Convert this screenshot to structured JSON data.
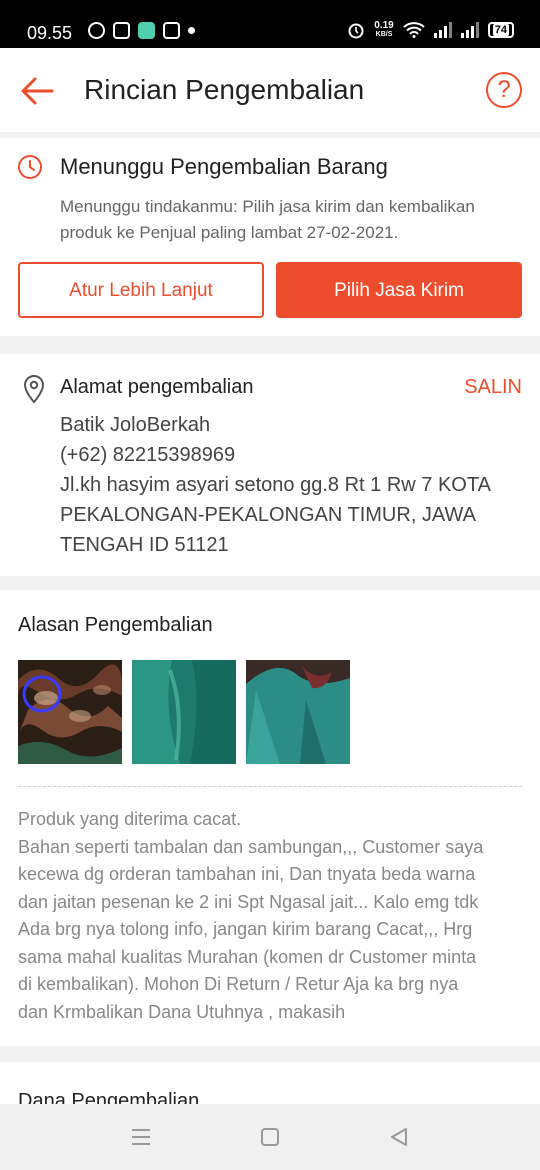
{
  "status_bar": {
    "time": "09.55",
    "speed_value": "0.19",
    "speed_unit": "KB/S",
    "battery": "74",
    "icons": [
      "plus-circle-icon",
      "notification-icon",
      "app-icon",
      "image-icon",
      "dot-icon",
      "alarm-icon",
      "wifi-icon",
      "signal-icon",
      "signal-icon",
      "battery-icon"
    ]
  },
  "header": {
    "title": "Rincian Pengembalian",
    "back_icon": "arrow-left-icon",
    "help_icon": "question-circle-icon",
    "help_symbol": "?"
  },
  "status_card": {
    "icon": "clock-icon",
    "title": "Menunggu Pengembalian Barang",
    "description": "Menunggu tindakanmu: Pilih jasa kirim dan kembalikan produk ke Penjual paling lambat 27-02-2021.",
    "secondary_button": "Atur Lebih Lanjut",
    "primary_button": "Pilih Jasa Kirim"
  },
  "address_card": {
    "icon": "location-pin-icon",
    "label": "Alamat pengembalian",
    "copy_label": "SALIN",
    "name": "Batik JoloBerkah",
    "phone": "(+62) 82215398969",
    "address": "Jl.kh hasyim asyari setono gg.8 Rt 1 Rw 7 KOTA PEKALONGAN-PEKALONGAN TIMUR, JAWA TENGAH ID 51121"
  },
  "reason_card": {
    "title": "Alasan Pengembalian",
    "photos": [
      "fabric-photo-defect",
      "green-satin-photo",
      "green-dress-photo"
    ],
    "reason_lines": [
      "Produk yang diterima cacat.",
      "Bahan seperti tambalan dan sambungan,,, Customer saya",
      "kecewa dg orderan tambahan ini, Dan tnyata beda warna",
      "dan jaitan pesenan ke 2 ini Spt Ngasal jait... Kalo emg tdk",
      "Ada brg nya tolong info, jangan kirim barang Cacat,,, Hrg",
      "sama mahal kualitas Murahan (komen dr Customer minta",
      "di kembalikan). Mohon Di Return / Retur Aja ka brg nya",
      "dan Krmbalikan Dana Utuhnya , makasih"
    ]
  },
  "refund_card": {
    "title": "Dana Pengembalian"
  },
  "nav_bar": {
    "icons": [
      "menu-icon",
      "home-square-icon",
      "back-triangle-icon"
    ]
  },
  "colors": {
    "accent": "#ee4d2d",
    "text": "#222222",
    "muted": "#888888"
  }
}
